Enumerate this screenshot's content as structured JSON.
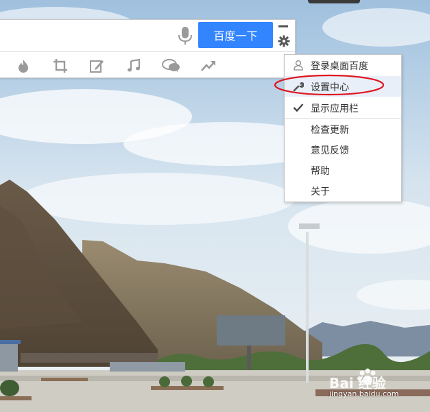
{
  "search": {
    "placeholder": "",
    "button_label": "百度一下"
  },
  "toolbar": {
    "icons": [
      "fire-icon",
      "crop-icon",
      "edit-icon",
      "music-icon",
      "chat-icon",
      "trend-icon"
    ]
  },
  "menu": {
    "items": [
      {
        "label": "登录桌面百度",
        "icon": "user-icon"
      },
      {
        "label": "设置中心",
        "icon": "wrench-icon",
        "highlighted": true
      },
      {
        "label": "显示应用栏",
        "icon": "check-icon",
        "checked": true
      },
      {
        "label": "检查更新"
      },
      {
        "label": "意见反馈"
      },
      {
        "label": "帮助"
      },
      {
        "label": "关于"
      }
    ]
  },
  "annotation": {
    "color": "#e0141e"
  },
  "colors": {
    "accent": "#3385ff",
    "icon_gray": "#9a9a9a"
  },
  "watermark": {
    "logo_text": "Bai 经验",
    "url": "jingyan.baidu.com"
  }
}
